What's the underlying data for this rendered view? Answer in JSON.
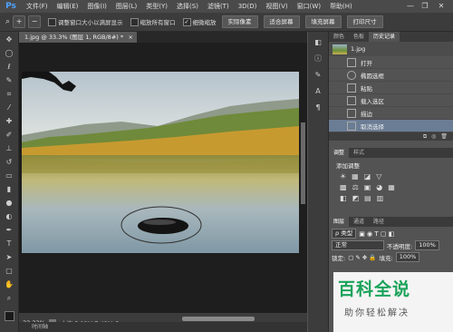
{
  "app": {
    "logo": "Ps"
  },
  "menu": [
    "文件(F)",
    "编辑(E)",
    "图像(I)",
    "图层(L)",
    "类型(Y)",
    "选择(S)",
    "滤镜(T)",
    "3D(D)",
    "视图(V)",
    "窗口(W)",
    "帮助(H)"
  ],
  "window_controls": {
    "minimize": "—",
    "restore": "❐",
    "close": "✕"
  },
  "options": {
    "zoom_in": "+",
    "zoom_out": "−",
    "resize_windows": "调整窗口大小以满屏显示",
    "zoom_all": "缩放所有窗口",
    "scrubby_zoom": "细微缩放",
    "scrubby_zoom_checked": "✓",
    "actual_pixels": "实际像素",
    "fit_screen": "适合屏幕",
    "fill_screen": "填充屏幕",
    "print_size": "打印尺寸"
  },
  "document": {
    "tab_label": "1.jpg @ 33.3% (图层 1, RGB/8#) *",
    "close_symbol": "×"
  },
  "status": {
    "zoom": "33.33%",
    "doc_info": "文档:5.93M/7.43M",
    "arrow": "▶"
  },
  "timeline": {
    "label": "时间轴"
  },
  "history_panel": {
    "tabs": [
      "颜色",
      "色板",
      "历史记录"
    ],
    "snapshot": "1.jpg",
    "items": [
      "打开",
      "椭圆选框",
      "粘贴",
      "载入选区",
      "描边",
      "取消选择"
    ],
    "selected_index": 5
  },
  "adjustments_panel": {
    "tabs": [
      "调整",
      "样式"
    ],
    "title": "添加调整",
    "row1": [
      "☀",
      "▦",
      "◪",
      "▽"
    ],
    "row2": [
      "▩",
      "⚖",
      "▣",
      "◕",
      "▦"
    ],
    "row3": [
      "◧",
      "◩",
      "▤",
      "▥"
    ]
  },
  "layers_panel": {
    "tabs": [
      "图层",
      "通道",
      "路径"
    ],
    "kind": "ρ 类型",
    "blend_mode": "正常",
    "opacity_label": "不透明度:",
    "opacity": "100%",
    "lock_label": "锁定:",
    "fill_label": "填充:",
    "fill": "100%"
  },
  "watermark": {
    "main": "百科全说",
    "sub": "助你轻松解决"
  },
  "colors": {
    "accent": "#6b7d95",
    "watermark_green": "#1aa35a"
  }
}
